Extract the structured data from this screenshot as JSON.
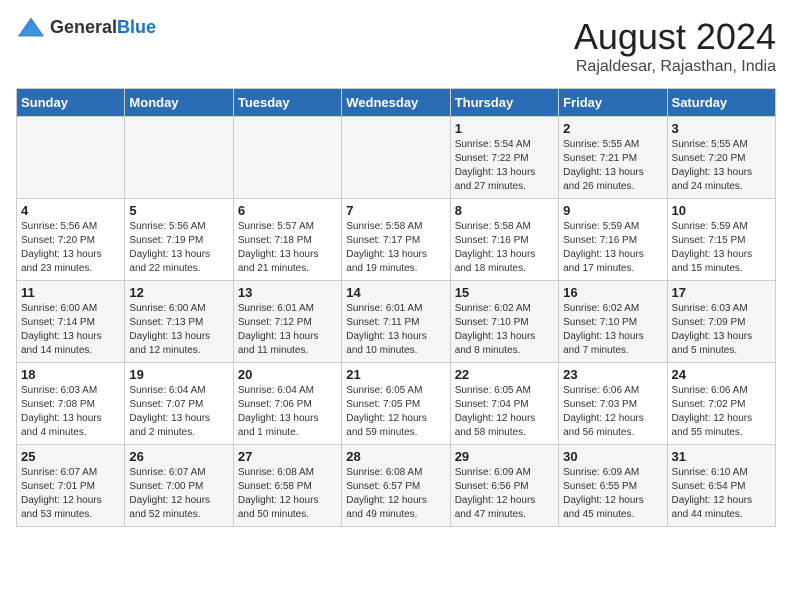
{
  "header": {
    "logo_general": "General",
    "logo_blue": "Blue",
    "month_year": "August 2024",
    "location": "Rajaldesar, Rajasthan, India"
  },
  "calendar": {
    "weekdays": [
      "Sunday",
      "Monday",
      "Tuesday",
      "Wednesday",
      "Thursday",
      "Friday",
      "Saturday"
    ],
    "weeks": [
      [
        {
          "day": "",
          "info": ""
        },
        {
          "day": "",
          "info": ""
        },
        {
          "day": "",
          "info": ""
        },
        {
          "day": "",
          "info": ""
        },
        {
          "day": "1",
          "info": "Sunrise: 5:54 AM\nSunset: 7:22 PM\nDaylight: 13 hours\nand 27 minutes."
        },
        {
          "day": "2",
          "info": "Sunrise: 5:55 AM\nSunset: 7:21 PM\nDaylight: 13 hours\nand 26 minutes."
        },
        {
          "day": "3",
          "info": "Sunrise: 5:55 AM\nSunset: 7:20 PM\nDaylight: 13 hours\nand 24 minutes."
        }
      ],
      [
        {
          "day": "4",
          "info": "Sunrise: 5:56 AM\nSunset: 7:20 PM\nDaylight: 13 hours\nand 23 minutes."
        },
        {
          "day": "5",
          "info": "Sunrise: 5:56 AM\nSunset: 7:19 PM\nDaylight: 13 hours\nand 22 minutes."
        },
        {
          "day": "6",
          "info": "Sunrise: 5:57 AM\nSunset: 7:18 PM\nDaylight: 13 hours\nand 21 minutes."
        },
        {
          "day": "7",
          "info": "Sunrise: 5:58 AM\nSunset: 7:17 PM\nDaylight: 13 hours\nand 19 minutes."
        },
        {
          "day": "8",
          "info": "Sunrise: 5:58 AM\nSunset: 7:16 PM\nDaylight: 13 hours\nand 18 minutes."
        },
        {
          "day": "9",
          "info": "Sunrise: 5:59 AM\nSunset: 7:16 PM\nDaylight: 13 hours\nand 17 minutes."
        },
        {
          "day": "10",
          "info": "Sunrise: 5:59 AM\nSunset: 7:15 PM\nDaylight: 13 hours\nand 15 minutes."
        }
      ],
      [
        {
          "day": "11",
          "info": "Sunrise: 6:00 AM\nSunset: 7:14 PM\nDaylight: 13 hours\nand 14 minutes."
        },
        {
          "day": "12",
          "info": "Sunrise: 6:00 AM\nSunset: 7:13 PM\nDaylight: 13 hours\nand 12 minutes."
        },
        {
          "day": "13",
          "info": "Sunrise: 6:01 AM\nSunset: 7:12 PM\nDaylight: 13 hours\nand 11 minutes."
        },
        {
          "day": "14",
          "info": "Sunrise: 6:01 AM\nSunset: 7:11 PM\nDaylight: 13 hours\nand 10 minutes."
        },
        {
          "day": "15",
          "info": "Sunrise: 6:02 AM\nSunset: 7:10 PM\nDaylight: 13 hours\nand 8 minutes."
        },
        {
          "day": "16",
          "info": "Sunrise: 6:02 AM\nSunset: 7:10 PM\nDaylight: 13 hours\nand 7 minutes."
        },
        {
          "day": "17",
          "info": "Sunrise: 6:03 AM\nSunset: 7:09 PM\nDaylight: 13 hours\nand 5 minutes."
        }
      ],
      [
        {
          "day": "18",
          "info": "Sunrise: 6:03 AM\nSunset: 7:08 PM\nDaylight: 13 hours\nand 4 minutes."
        },
        {
          "day": "19",
          "info": "Sunrise: 6:04 AM\nSunset: 7:07 PM\nDaylight: 13 hours\nand 2 minutes."
        },
        {
          "day": "20",
          "info": "Sunrise: 6:04 AM\nSunset: 7:06 PM\nDaylight: 13 hours\nand 1 minute."
        },
        {
          "day": "21",
          "info": "Sunrise: 6:05 AM\nSunset: 7:05 PM\nDaylight: 12 hours\nand 59 minutes."
        },
        {
          "day": "22",
          "info": "Sunrise: 6:05 AM\nSunset: 7:04 PM\nDaylight: 12 hours\nand 58 minutes."
        },
        {
          "day": "23",
          "info": "Sunrise: 6:06 AM\nSunset: 7:03 PM\nDaylight: 12 hours\nand 56 minutes."
        },
        {
          "day": "24",
          "info": "Sunrise: 6:06 AM\nSunset: 7:02 PM\nDaylight: 12 hours\nand 55 minutes."
        }
      ],
      [
        {
          "day": "25",
          "info": "Sunrise: 6:07 AM\nSunset: 7:01 PM\nDaylight: 12 hours\nand 53 minutes."
        },
        {
          "day": "26",
          "info": "Sunrise: 6:07 AM\nSunset: 7:00 PM\nDaylight: 12 hours\nand 52 minutes."
        },
        {
          "day": "27",
          "info": "Sunrise: 6:08 AM\nSunset: 6:58 PM\nDaylight: 12 hours\nand 50 minutes."
        },
        {
          "day": "28",
          "info": "Sunrise: 6:08 AM\nSunset: 6:57 PM\nDaylight: 12 hours\nand 49 minutes."
        },
        {
          "day": "29",
          "info": "Sunrise: 6:09 AM\nSunset: 6:56 PM\nDaylight: 12 hours\nand 47 minutes."
        },
        {
          "day": "30",
          "info": "Sunrise: 6:09 AM\nSunset: 6:55 PM\nDaylight: 12 hours\nand 45 minutes."
        },
        {
          "day": "31",
          "info": "Sunrise: 6:10 AM\nSunset: 6:54 PM\nDaylight: 12 hours\nand 44 minutes."
        }
      ]
    ]
  }
}
